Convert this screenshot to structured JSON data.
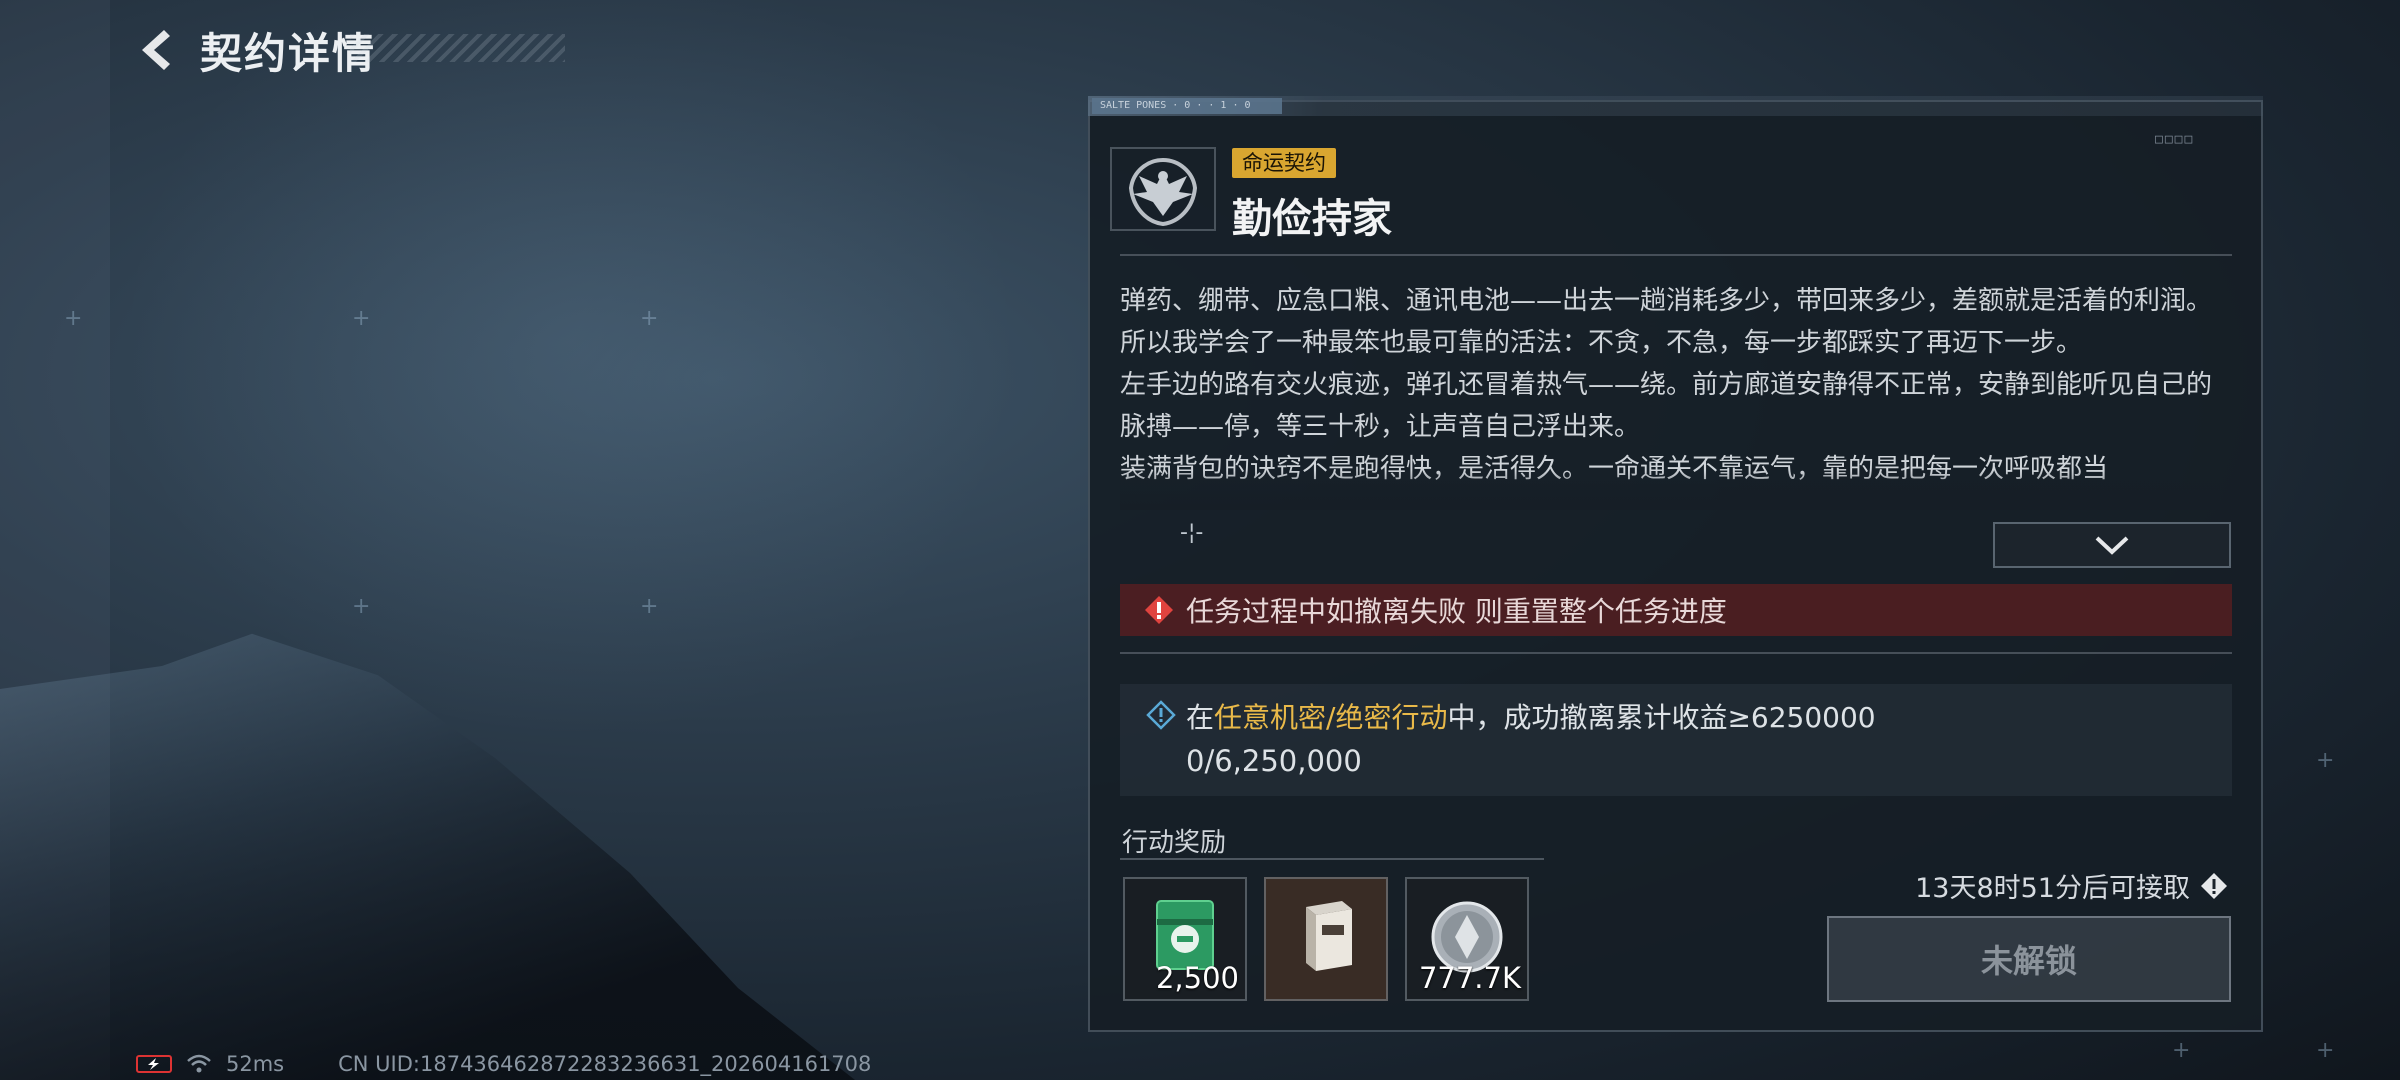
{
  "header": {
    "title": "契约详情"
  },
  "panel": {
    "topbar_tag": "SALTE PONES · 0 · · 1 · 0",
    "corner_marks": "□□□□",
    "badge": "命运契约",
    "title": "勤俭持家",
    "story": [
      "弹药、绷带、应急口粮、通讯电池——出去一趟消耗多少，带回来多少，差额就是活着的利润。",
      "所以我学会了一种最笨也最可靠的活法：不贪，不急，每一步都踩实了再迈下一步。",
      "左手边的路有交火痕迹，弹孔还冒着热气——绕。前方廊道安静得不正常，安静到能听见自己的脉搏——停，等三十秒，让声音自己浮出来。",
      "装满背包的诀窍不是跑得快，是活得久。一命通关不靠运气，靠的是把每一次呼吸都当"
    ],
    "warning": "任务过程中如撤离失败 则重置整个任务进度",
    "objective": {
      "prefix": "在",
      "highlight": "任意机密/绝密行动",
      "suffix": "中，成功撤离累计收益≥6250000",
      "progress": "0/6,250,000"
    },
    "rewards_label": "行动奖励",
    "rewards": [
      {
        "icon": "green-case-icon",
        "quantity": "2,500"
      },
      {
        "icon": "supply-box-icon",
        "quantity": ""
      },
      {
        "icon": "silver-coin-icon",
        "quantity": "777.7K"
      }
    ],
    "timer": "13天8时51分后可接取",
    "unlock_button": "未解锁"
  },
  "status": {
    "ping": "52ms",
    "uid": "CN UID:18743646287228323663​1_202604161708"
  },
  "colors": {
    "badge": "#d9a630",
    "highlight": "#e9b949",
    "warning_bg": "#6e1e1e"
  }
}
